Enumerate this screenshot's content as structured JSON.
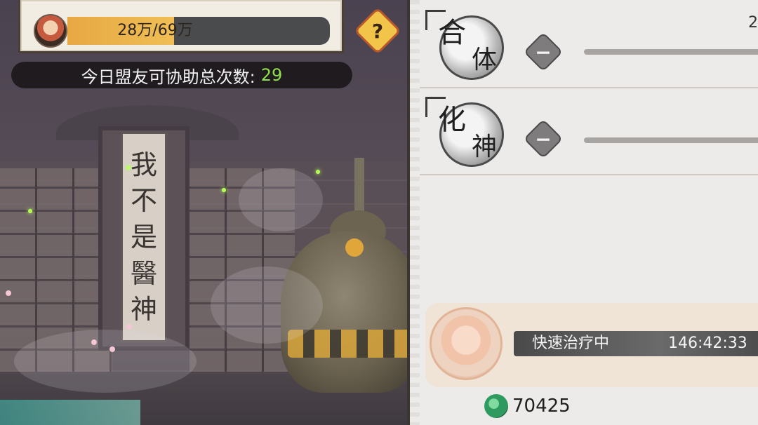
{
  "hud": {
    "heal_progress_text": "28万/69万",
    "heal_progress_fraction": 0.406,
    "help_icon": "?",
    "assist_label": "今日盟友可协助总次数:",
    "assist_value": "29"
  },
  "scene": {
    "scroll_chars": [
      "我",
      "不",
      "是",
      "醫",
      "神"
    ]
  },
  "realms": [
    {
      "char1": "合",
      "char2": "体",
      "count": "2",
      "minus_icon": "−"
    },
    {
      "char1": "化",
      "char2": "神",
      "minus_icon": "−"
    }
  ],
  "treatment": {
    "label": "快速治疗中",
    "timer": "146:42:33"
  },
  "currency": {
    "icon": "jade-icon",
    "value": "70425"
  },
  "colors": {
    "progress_fill": "#f0be55",
    "assist_value": "#8ee14c",
    "help_button": "#f2c44a"
  }
}
